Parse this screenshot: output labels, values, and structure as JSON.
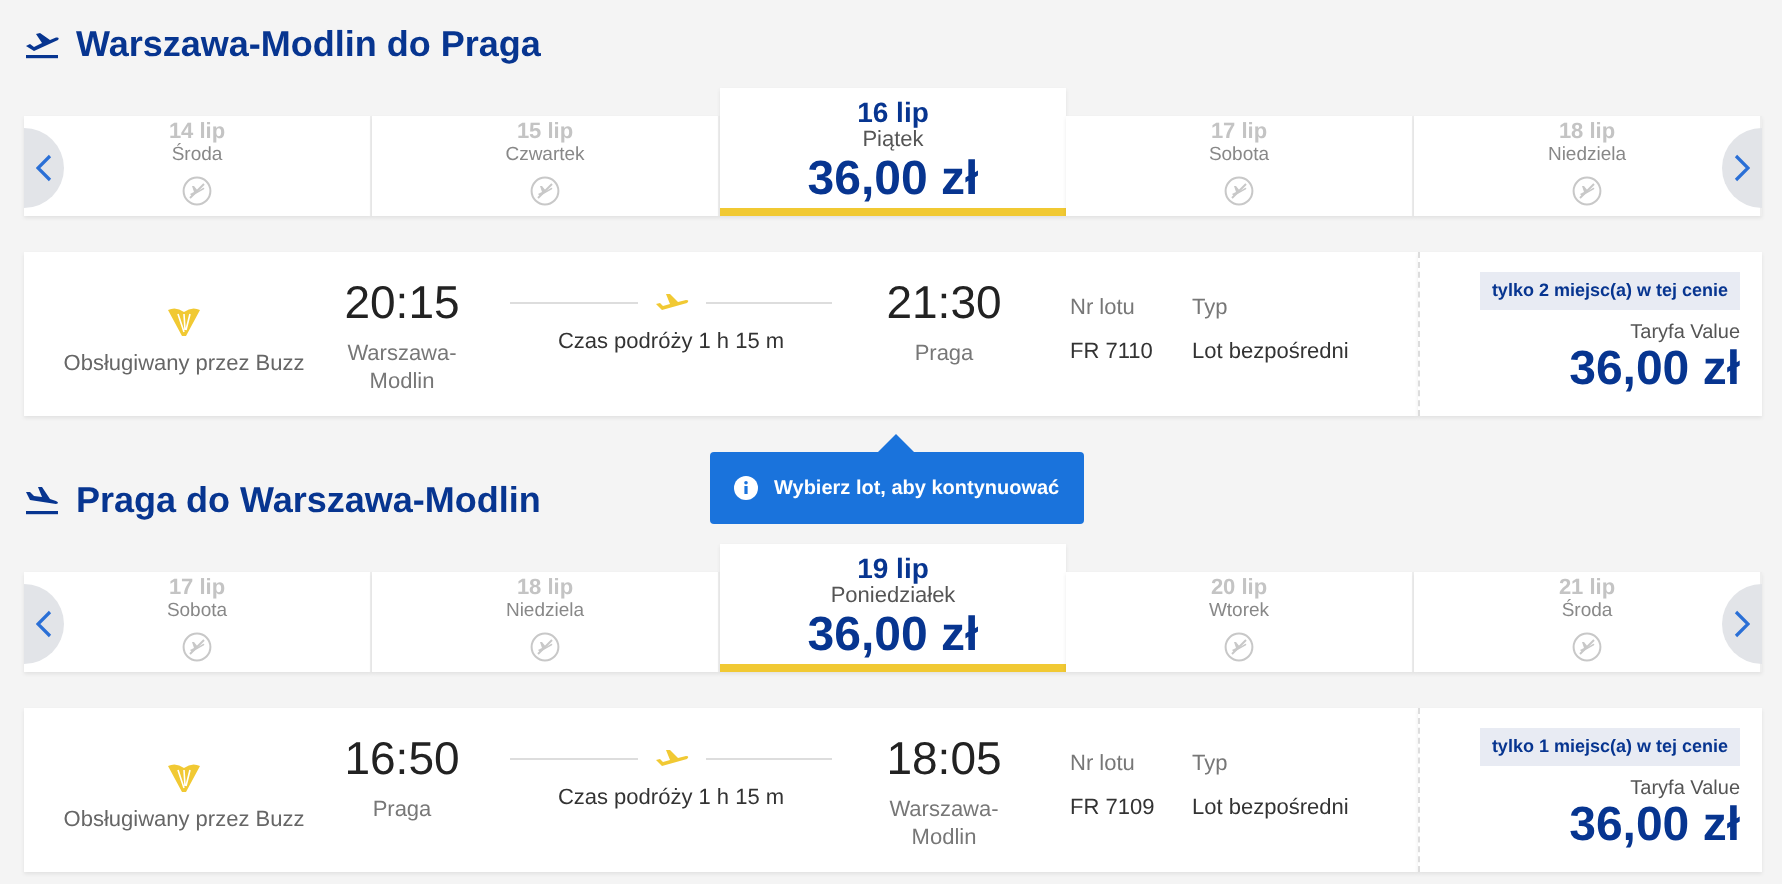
{
  "sections": [
    {
      "kind": "outbound",
      "title": "Warszawa-Modlin do Praga",
      "dates": [
        {
          "date": "14 lip",
          "day": "Środa",
          "selected": false
        },
        {
          "date": "15 lip",
          "day": "Czwartek",
          "selected": false
        },
        {
          "date": "16 lip",
          "day": "Piątek",
          "price": "36,00 zł",
          "selected": true
        },
        {
          "date": "17 lip",
          "day": "Sobota",
          "selected": false
        },
        {
          "date": "18 lip",
          "day": "Niedziela",
          "selected": false
        }
      ],
      "flight": {
        "operator": "Obsługiwany przez Buzz",
        "dep_time": "20:15",
        "dep_airport": "Warszawa-Modlin",
        "duration": "Czas podróży 1 h 15 m",
        "arr_time": "21:30",
        "arr_airport": "Praga",
        "flight_no_label": "Nr lotu",
        "flight_no": "FR 7110",
        "type_label": "Typ",
        "type": "Lot bezpośredni",
        "seats": "tylko 2 miejsc(a) w tej cenie",
        "fare": "Taryfa Value",
        "price": "36,00 zł"
      },
      "tooltip": "Wybierz lot, aby kontynuować"
    },
    {
      "kind": "inbound",
      "title": "Praga do Warszawa-Modlin",
      "dates": [
        {
          "date": "17 lip",
          "day": "Sobota",
          "selected": false
        },
        {
          "date": "18 lip",
          "day": "Niedziela",
          "selected": false
        },
        {
          "date": "19 lip",
          "day": "Poniedziałek",
          "price": "36,00 zł",
          "selected": true
        },
        {
          "date": "20 lip",
          "day": "Wtorek",
          "selected": false
        },
        {
          "date": "21 lip",
          "day": "Środa",
          "selected": false
        }
      ],
      "flight": {
        "operator": "Obsługiwany przez Buzz",
        "dep_time": "16:50",
        "dep_airport": "Praga",
        "duration": "Czas podróży 1 h 15 m",
        "arr_time": "18:05",
        "arr_airport": "Warszawa-Modlin",
        "flight_no_label": "Nr lotu",
        "flight_no": "FR 7109",
        "type_label": "Typ",
        "type": "Lot bezpośredni",
        "seats": "tylko 1 miejsc(a) w tej cenie",
        "fare": "Taryfa Value",
        "price": "36,00 zł"
      }
    }
  ]
}
